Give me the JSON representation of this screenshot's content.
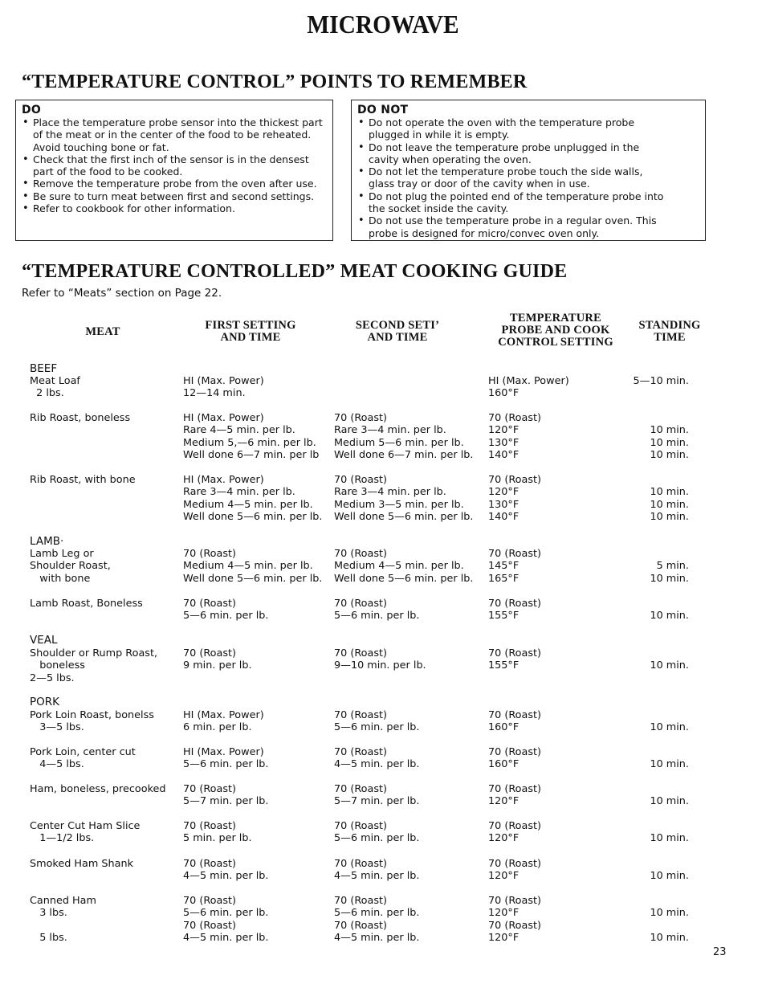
{
  "page_title": "MICROWAVE",
  "points_section": {
    "heading": "“TEMPERATURE CONTROL” POINTS TO REMEMBER",
    "do_box": {
      "heading": "DO",
      "items": [
        "Place the temperature probe sensor into the thickest part of the meat or in the center of the food to be reheated. Avoid touching bone or fat.",
        "Check that the first inch of the sensor is in the densest part of the food to be cooked.",
        "Remove the temperature probe from the oven after use.",
        "Be sure to turn meat between first and second settings.",
        "Refer to cookbook for other information."
      ]
    },
    "do_not_box": {
      "heading": "DO NOT",
      "items": [
        "Do not operate the oven with the temperature probe plugged in while it is empty.",
        "Do not leave the temperature probe unplugged in the cavity when operating the oven.",
        "Do not let the temperature probe touch the side walls, glass tray or door of the cavity when in use.",
        "Do not plug the pointed end of the temperature probe into the socket inside the cavity.",
        "Do not use the temperature probe in a regular oven. This probe is designed for micro/convec oven only."
      ]
    }
  },
  "guide": {
    "heading": "“TEMPERATURE CONTROLLED” MEAT COOKING GUIDE",
    "note": "Refer to “Meats” section on Page 22.",
    "columns": [
      "MEAT",
      "FIRST SETTING\nAND TIME",
      "SECOND SETI’\nAND TIME",
      "TEMPERATURE\nPROBE AND COOK\nCONTROL SETTING",
      "STANDING\nTIME"
    ],
    "categories": [
      {
        "label": "BEEF"
      },
      {
        "label": "LAMB·"
      },
      {
        "label": "VEAL"
      },
      {
        "label": "PORK"
      }
    ],
    "rows": [
      {
        "meat": "Meat Loaf\n  2 lbs.",
        "first": "HI (Max. Power)\n12—14 min.",
        "second": "",
        "probe": "HI (Max. Power)\n160°F",
        "standing": "5—10 min."
      },
      {
        "meat": "Rib Roast, boneless",
        "first": "HI (Max. Power)\nRare 4—5 min. per lb.\nMedium 5,—6 min. per lb.\nWell done 6—7 min. per lb",
        "second": "70 (Roast)\nRare 3—4 min. per lb.\nMedium 5—6 min. per lb.\nWell done 6—7 min. per lb.",
        "probe": "70 (Roast)\n120°F\n130°F\n140°F",
        "standing": "\n10 min.\n10 min.\n10 min."
      },
      {
        "meat": "Rib Roast, with bone",
        "first": "HI (Max. Power)\nRare 3—4 min. per lb.\nMedium 4—5 min. per lb.\nWell done 5—6 min. per lb.",
        "second": "70 (Roast)\nRare 3—4 min. per lb.\nMedium 3—5 min. per lb.\nWell done 5—6 min. per lb.",
        "probe": "70 (Roast)\n120°F\n130°F\n140°F",
        "standing": "\n10 min.\n10 min.\n10 min."
      },
      {
        "meat": "Lamb Leg or\nShoulder Roast,\n   with bone",
        "first": "70 (Roast)\nMedium 4—5 min. per lb.\nWell done 5—6 min. per lb.",
        "second": "70 (Roast)\nMedium 4—5 min. per lb.\nWell done 5—6 min. per lb.",
        "probe": "70 (Roast)\n145°F\n165°F",
        "standing": "\n5 min.\n10 min."
      },
      {
        "meat": "Lamb Roast, Boneless",
        "first": "70 (Roast)\n5—6 min. per lb.",
        "second": "70 (Roast)\n5—6 min. per lb.",
        "probe": "70 (Roast)\n155°F",
        "standing": "\n10 min."
      },
      {
        "meat": "Shoulder or Rump Roast,\n   boneless\n2—5 lbs.",
        "first": "70 (Roast)\n9 min. per lb.",
        "second": "70 (Roast)\n9—10 min. per lb.",
        "probe": "70 (Roast)\n155°F",
        "standing": "\n10 min."
      },
      {
        "meat": "Pork Loin Roast, bonelss\n   3—5 lbs.",
        "first": "HI (Max. Power)\n6 min. per lb.",
        "second": "70 (Roast)\n5—6 min. per lb.",
        "probe": "70 (Roast)\n160°F",
        "standing": "\n10 min."
      },
      {
        "meat": "Pork Loin, center cut\n   4—5 lbs.",
        "first": "HI (Max. Power)\n5—6 min. per lb.",
        "second": "70 (Roast)\n4—5 min. per lb.",
        "probe": "70 (Roast)\n160°F",
        "standing": "\n10 min."
      },
      {
        "meat": "Ham, boneless, precooked",
        "first": "70 (Roast)\n5—7 min. per lb.",
        "second": "70 (Roast)\n5—7 min. per lb.",
        "probe": "70 (Roast)\n120°F",
        "standing": "\n10 min."
      },
      {
        "meat": "Center Cut Ham Slice\n   1—1/2 lbs.",
        "first": "70 (Roast)\n5 min. per lb.",
        "second": "70 (Roast)\n5—6 min. per lb.",
        "probe": "70 (Roast)\n120°F",
        "standing": "\n10 min."
      },
      {
        "meat": "Smoked Ham Shank",
        "first": "70 (Roast)\n4—5 min. per lb.",
        "second": "70 (Roast)\n4—5 min. per lb.",
        "probe": "70 (Roast)\n120°F",
        "standing": "\n10 min."
      },
      {
        "meat": "Canned Ham\n   3 lbs.\n\n   5 lbs.",
        "first": "70 (Roast)\n5—6 min. per lb.\n70 (Roast)\n4—5 min. per lb.",
        "second": "70 (Roast)\n5—6 min. per lb.\n70 (Roast)\n4—5 min. per lb.",
        "probe": "70 (Roast)\n120°F\n70 (Roast)\n120°F",
        "standing": "\n10 min.\n\n10 min."
      }
    ]
  },
  "page_number": "23"
}
